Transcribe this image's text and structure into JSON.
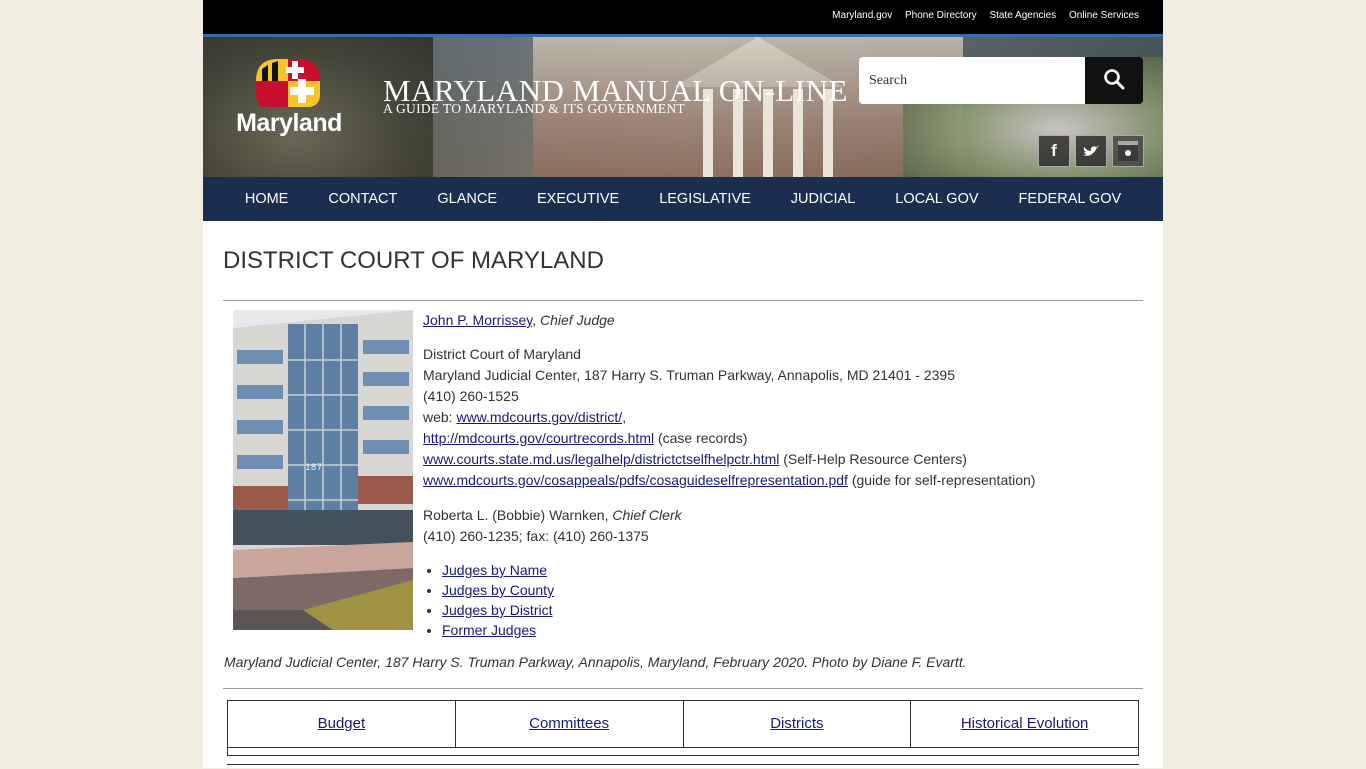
{
  "toplinks": [
    "Maryland.gov",
    "Phone Directory",
    "State Agencies",
    "Online Services"
  ],
  "logo": {
    "word": "Maryland"
  },
  "site": {
    "title": "MARYLAND MANUAL ON-LINE",
    "subtitle": "A GUIDE TO MARYLAND & ITS GOVERNMENT"
  },
  "search": {
    "placeholder": "Search",
    "icon": "search-icon"
  },
  "social": {
    "icons": [
      "facebook-icon",
      "twitter-icon",
      "flickr-icon"
    ],
    "facebook_glyph": "f"
  },
  "nav": [
    "HOME",
    "CONTACT",
    "GLANCE",
    "EXECUTIVE",
    "LEGISLATIVE",
    "JUDICIAL",
    "LOCAL GOV",
    "FEDERAL GOV"
  ],
  "page": {
    "title": "DISTRICT COURT OF MARYLAND"
  },
  "judge": {
    "name": "John P. Morrissey",
    "title": "Chief Judge"
  },
  "address": {
    "org": "District Court of Maryland",
    "street": "Maryland Judicial Center, 187 Harry S. Truman Parkway, Annapolis, MD 21401 - 2395",
    "phone": "(410) 260-1525",
    "web_prefix": "web:",
    "web1": "www.mdcourts.gov/district/",
    "link2": "http://mdcourts.gov/courtrecords.html",
    "link2_note": "(case records)",
    "link3": "www.courts.state.md.us/legalhelp/districtctselfhelpctr.html",
    "link3_note": "(Self-Help Resource Centers)",
    "link4": "www.mdcourts.gov/cosappeals/pdfs/cosaguideselfrepresentation.pdf",
    "link4_note": "(guide for self-representation)"
  },
  "clerk": {
    "name": "Roberta L. (Bobbie) Warnken,",
    "title": "Chief Clerk",
    "phone": "(410) 260-1235; fax: (410) 260-1375"
  },
  "judge_links": [
    "Judges by Name",
    "Judges by County",
    "Judges by District",
    "Former Judges"
  ],
  "photo": {
    "building_number": "187"
  },
  "caption": "Maryland Judicial Center, 187 Harry S. Truman Parkway, Annapolis, Maryland, February 2020. Photo by Diane F. Evartt.",
  "table_links": [
    "Budget",
    "Committees",
    "Districts",
    "Historical Evolution"
  ]
}
